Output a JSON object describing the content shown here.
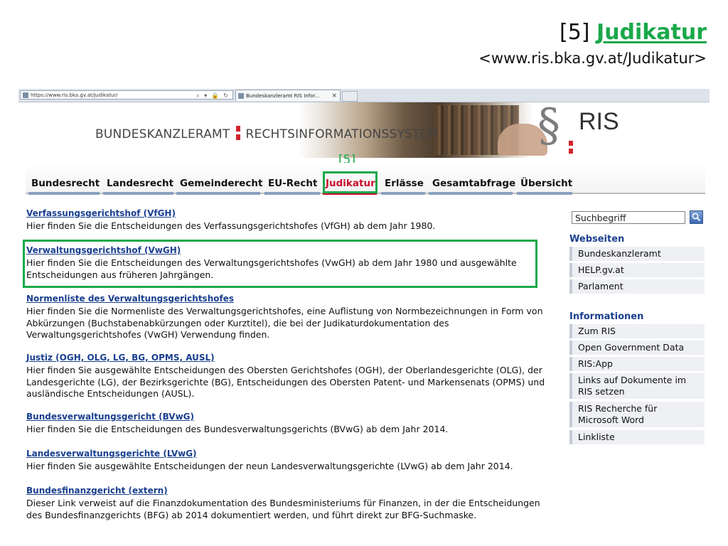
{
  "slide": {
    "number": "[5]",
    "title_link": "Judikatur",
    "url": "<www.ris.bka.gv.at/Judikatur>",
    "marker": "[5]"
  },
  "browser": {
    "address": "https://www.ris.bka.gv.at/Judikatur/",
    "address_controls": "⌕ ▾ 🔒 ↻",
    "tab_title": "Bundeskanzleramt RIS Infor...",
    "tab_close": "×"
  },
  "header": {
    "org": "BUNDESKANZLERAMT",
    "system": "RECHTSINFORMATIONSSYSTEM",
    "logo_paragraph": "§",
    "logo_text": "RIS"
  },
  "nav": {
    "items": [
      "Bundesrecht",
      "Landesrecht",
      "Gemeinderecht",
      "EU-Recht",
      "Judikatur",
      "Erlässe",
      "Gesamtabfrage",
      "Übersicht"
    ],
    "active": "Judikatur"
  },
  "entries": [
    {
      "title": "Verfassungsgerichtshof (VfGH)",
      "desc": "Hier finden Sie die Entscheidungen des Verfassungsgerichtshofes (VfGH) ab dem Jahr 1980."
    },
    {
      "title": "Verwaltungsgerichtshof (VwGH)",
      "desc": "Hier finden Sie die Entscheidungen des Verwaltungsgerichtshofes (VwGH) ab dem Jahr 1980 und ausgewählte Entscheidungen aus früheren Jahrgängen."
    },
    {
      "title": "Normenliste des Verwaltungsgerichtshofes",
      "desc": "Hier finden Sie die Normenliste des Verwaltungsgerichtshofes, eine Auflistung von Normbezeichnungen in Form von Abkürzungen (Buchstabenabkürzungen oder Kurztitel), die bei der Judikaturdokumentation des Verwaltungsgerichtshofes (VwGH) Verwendung finden."
    },
    {
      "title": "Justiz (OGH, OLG, LG, BG, OPMS, AUSL)",
      "desc": "Hier finden Sie ausgewählte Entscheidungen des Obersten Gerichtshofes (OGH), der Oberlandesgerichte (OLG), der Landesgerichte (LG), der Bezirksgerichte (BG), Entscheidungen des Obersten Patent- und Markensenats (OPMS) und ausländische Entscheidungen (AUSL)."
    },
    {
      "title": "Bundesverwaltungsgericht (BVwG)",
      "desc": "Hier finden Sie die Entscheidungen des Bundesverwaltungsgerichts (BVwG) ab dem Jahr 2014."
    },
    {
      "title": "Landesverwaltungsgerichte (LVwG)",
      "desc": "Hier finden Sie ausgewählte Entscheidungen der neun Landesverwaltungsgerichte (LVwG) ab dem Jahr 2014."
    },
    {
      "title": "Bundesfinanzgericht (extern)",
      "desc": "Dieser Link verweist auf die Finanzdokumentation des Bundesministeriums für Finanzen, in der die Entscheidungen des Bundesfinanzgerichts (BFG) ab 2014 dokumentiert werden, und führt direkt zur BFG-Suchmaske."
    }
  ],
  "sidebar": {
    "search_value": "Suchbegriff",
    "webseiten_heading": "Webseiten",
    "webseiten": [
      "Bundeskanzleramt",
      "HELP.gv.at",
      "Parlament"
    ],
    "informationen_heading": "Informationen",
    "informationen": [
      "Zum RIS",
      "Open Government Data",
      "RIS:App",
      "Links auf Dokumente im RIS setzen",
      "RIS Recherche für Microsoft Word",
      "Linkliste"
    ]
  },
  "colors": {
    "highlight": "#1aa84a",
    "link": "#1a3f8f",
    "active_nav": "#c8102e"
  }
}
